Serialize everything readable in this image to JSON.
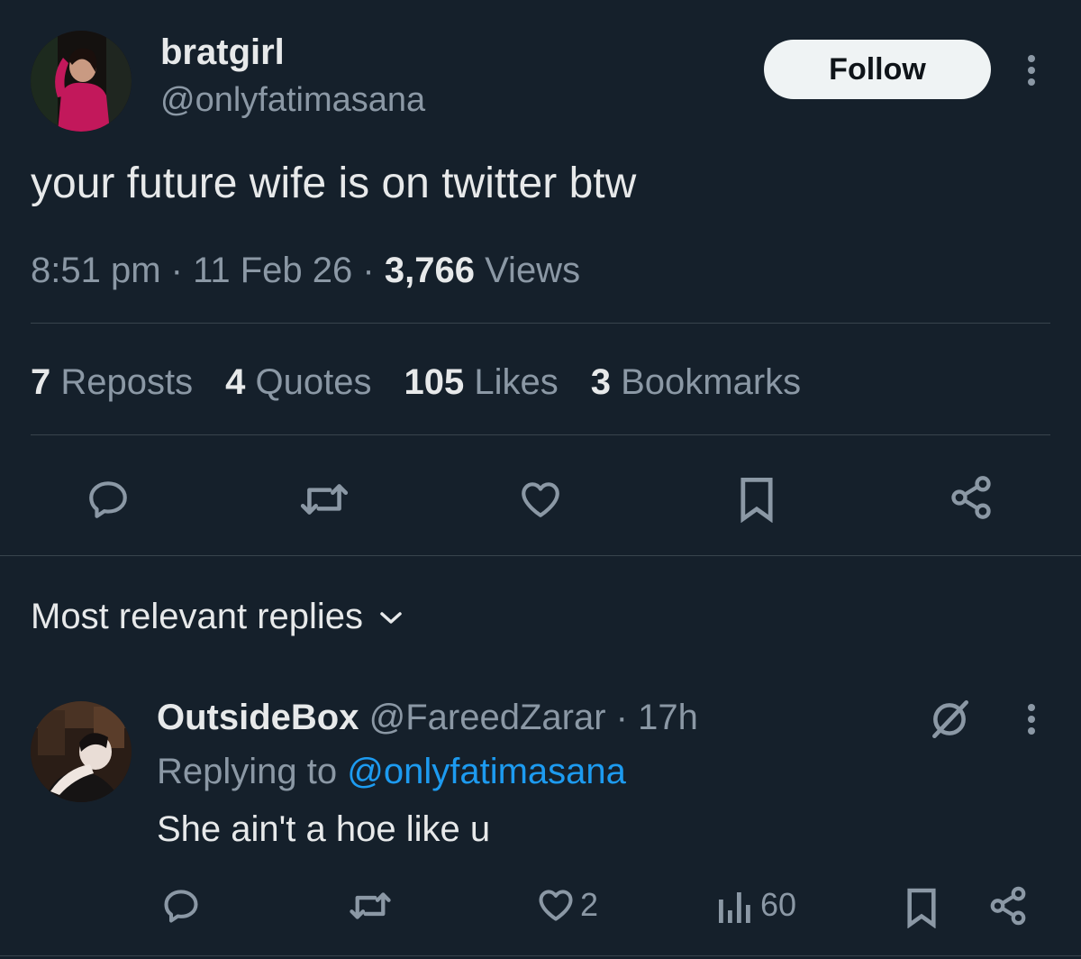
{
  "tweet": {
    "display_name": "bratgirl",
    "handle": "@onlyfatimasana",
    "follow_label": "Follow",
    "text": "your future wife is on twitter btw",
    "time": "8:51 pm",
    "sep1": "·",
    "date": "11 Feb 26",
    "sep2": "·",
    "views_count": "3,766",
    "views_label": "Views",
    "stats": {
      "reposts_count": "7",
      "reposts_label": "Reposts",
      "quotes_count": "4",
      "quotes_label": "Quotes",
      "likes_count": "105",
      "likes_label": "Likes",
      "bookmarks_count": "3",
      "bookmarks_label": "Bookmarks"
    },
    "actions": [
      "reply-icon",
      "repost-icon",
      "like-icon",
      "bookmark-icon",
      "share-icon"
    ]
  },
  "replies_header": {
    "label": "Most relevant replies"
  },
  "reply": {
    "display_name": "OutsideBox",
    "handle": "@FareedZarar",
    "sep": "·",
    "time": "17h",
    "replying_prefix": "Replying to",
    "replying_handle": "@onlyfatimasana",
    "text": "She ain't a hoe like u",
    "like_count": "2",
    "views_count": "60"
  },
  "colors": {
    "background": "#15202b",
    "text": "#e7e9ea",
    "muted": "#8b98a5",
    "link": "#1d9bf0",
    "divider": "#38444d"
  }
}
